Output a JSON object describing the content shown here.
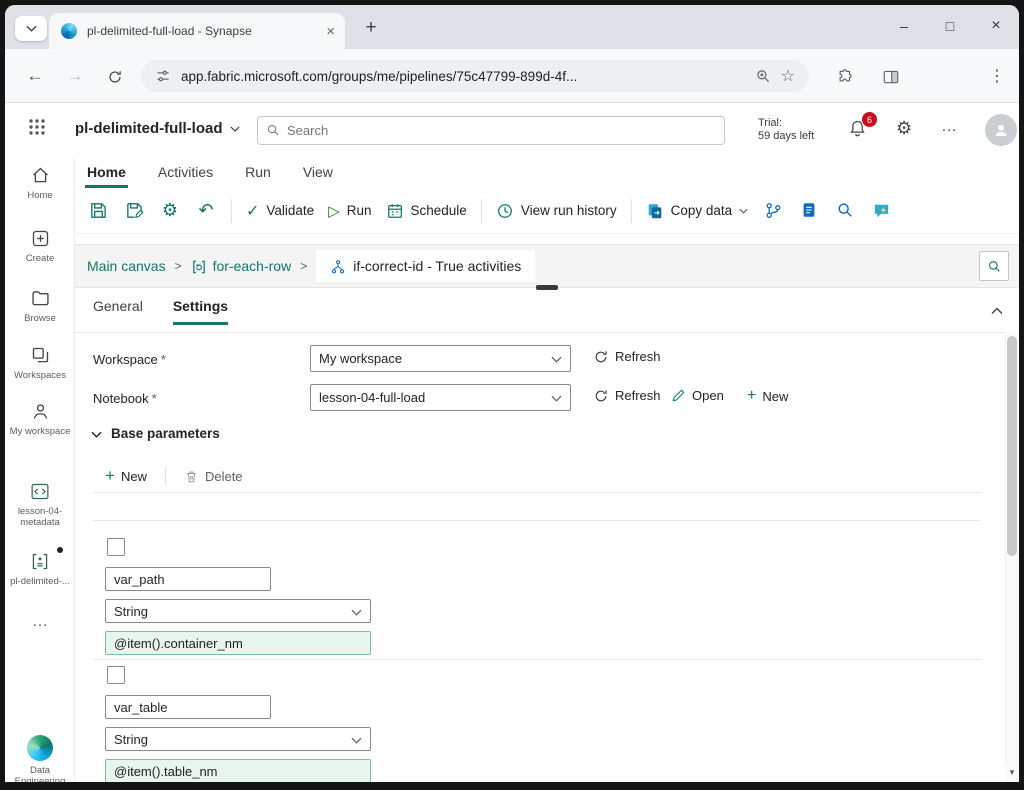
{
  "browser": {
    "tab_title": "pl-delimited-full-load - Synapse",
    "url": "app.fabric.microsoft.com/groups/me/pipelines/75c47799-899d-4f..."
  },
  "header": {
    "app_name": "pl-delimited-full-load",
    "search_placeholder": "Search",
    "trial_label": "Trial:",
    "trial_value": "59 days left",
    "notification_count": "6"
  },
  "ribbon": {
    "tabs": [
      {
        "label": "Home",
        "active": true
      },
      {
        "label": "Activities",
        "active": false
      },
      {
        "label": "Run",
        "active": false
      },
      {
        "label": "View",
        "active": false
      }
    ]
  },
  "toolbar": {
    "validate_label": "Validate",
    "run_label": "Run",
    "schedule_label": "Schedule",
    "history_label": "View run history",
    "copy_data_label": "Copy data"
  },
  "breadcrumb": {
    "main_canvas": "Main canvas",
    "separator": ">",
    "for_each": "for-each-row",
    "current": "if-correct-id - True activities"
  },
  "panel": {
    "tab_general": "General",
    "tab_settings": "Settings",
    "workspace_label": "Workspace",
    "required_mark": "*",
    "workspace_value": "My workspace",
    "refresh_label": "Refresh",
    "notebook_label": "Notebook",
    "notebook_value": "lesson-04-full-load",
    "open_label": "Open",
    "new_label": "New",
    "base_parameters_label": "Base parameters",
    "cmd_new": "New",
    "cmd_delete": "Delete",
    "parameters": [
      {
        "name": "var_path",
        "type": "String",
        "value": "@item().container_nm"
      },
      {
        "name": "var_table",
        "type": "String",
        "value": "@item().table_nm"
      }
    ]
  },
  "sidebar": {
    "items": [
      {
        "label": "Home"
      },
      {
        "label": "Create"
      },
      {
        "label": "Browse"
      },
      {
        "label": "Workspaces"
      },
      {
        "label": "My workspace"
      },
      {
        "label": "lesson-04-metadata"
      },
      {
        "label": "pl-delimited-..."
      },
      {
        "label": "Data Engineering"
      }
    ]
  },
  "colors": {
    "accent": "#117865",
    "param_value_bg": "#e7f5ec",
    "param_value_border": "#7fbf98",
    "badge": "#c50f1f"
  }
}
